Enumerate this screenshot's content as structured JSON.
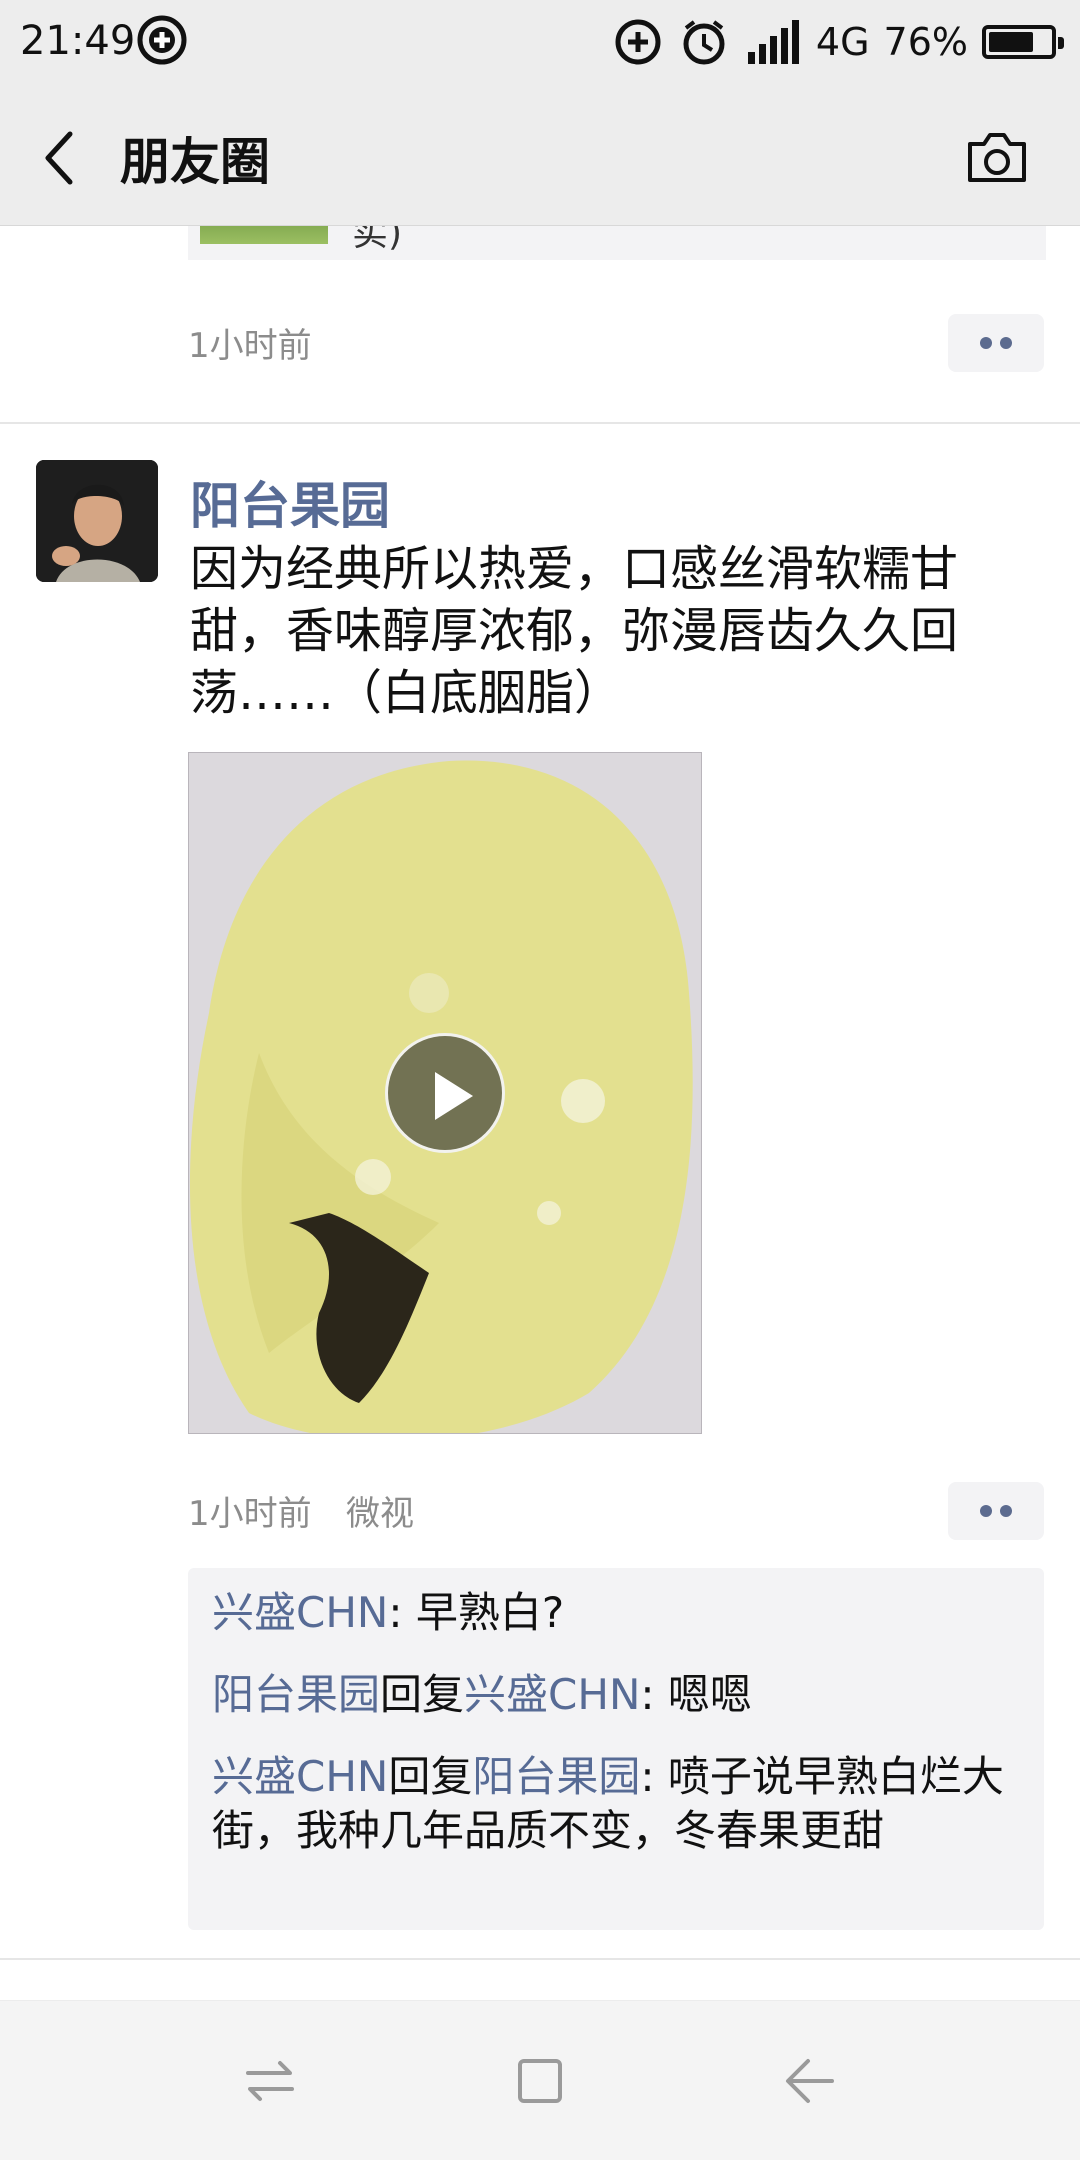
{
  "status": {
    "time": "21:49",
    "network": "4G",
    "battery": "76%",
    "battery_level": 0.76
  },
  "nav": {
    "title": "朋友圈",
    "back_icon": "chevron-left-icon",
    "camera_icon": "camera-icon"
  },
  "prev_post": {
    "time": "1小时前",
    "partial_text": "实)"
  },
  "post": {
    "author": "阳台果园",
    "text": "因为经典所以热爱，口感丝滑软糯甘甜，香味醇厚浓郁，弥漫唇齿久久回荡……（白底胭脂）",
    "time": "1小时前",
    "source": "微视",
    "comments": [
      {
        "user": "兴盛CHN",
        "reply_to": "",
        "text": ": 早熟白?"
      },
      {
        "user": "阳台果园",
        "reply_verb": "回复",
        "reply_to": "兴盛CHN",
        "text": ": 嗯嗯"
      },
      {
        "user": "兴盛CHN",
        "reply_verb": "回复",
        "reply_to": "阳台果园",
        "text": ": 喷子说早熟白烂大街，我种几年品质不变，冬春果更甜"
      }
    ]
  },
  "colors": {
    "link": "#576b95",
    "bar_bg": "#ededed",
    "comment_bg": "#f3f3f5"
  }
}
